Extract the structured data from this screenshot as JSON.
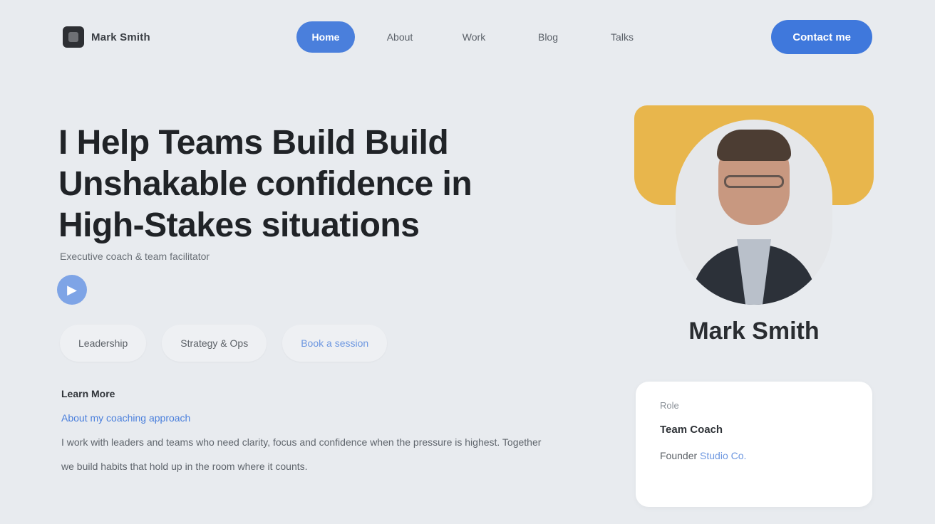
{
  "header": {
    "logo_text": "Mark Smith",
    "nav": [
      {
        "label": "Home",
        "active": true
      },
      {
        "label": "About"
      },
      {
        "label": "Work"
      },
      {
        "label": "Blog"
      },
      {
        "label": "Talks"
      }
    ],
    "cta_label": "Contact me"
  },
  "hero": {
    "title": "I Help Teams Build Build Unshakable confidence in High-Stakes situations",
    "subtitle": "Executive coach & team facilitator",
    "dot_icon": "play-icon",
    "pills": [
      {
        "label": "Leadership",
        "link": false
      },
      {
        "label": "Strategy & Ops",
        "link": false
      },
      {
        "label": "Book a session",
        "link": true
      }
    ],
    "body_lead": "Learn More",
    "body_link": "About my coaching approach",
    "body_text": "I work with leaders and teams who need clarity, focus and confidence when the pressure is highest. Together we build habits that hold up in the room where it counts."
  },
  "profile": {
    "name": "Mark Smith",
    "card": {
      "label": "Role",
      "value": "Team Coach",
      "row_prefix": "Founder",
      "row_link": "Studio Co."
    }
  },
  "colors": {
    "accent": "#4a7fdc",
    "band": "#e8b64c",
    "background": "#e8ebef"
  }
}
